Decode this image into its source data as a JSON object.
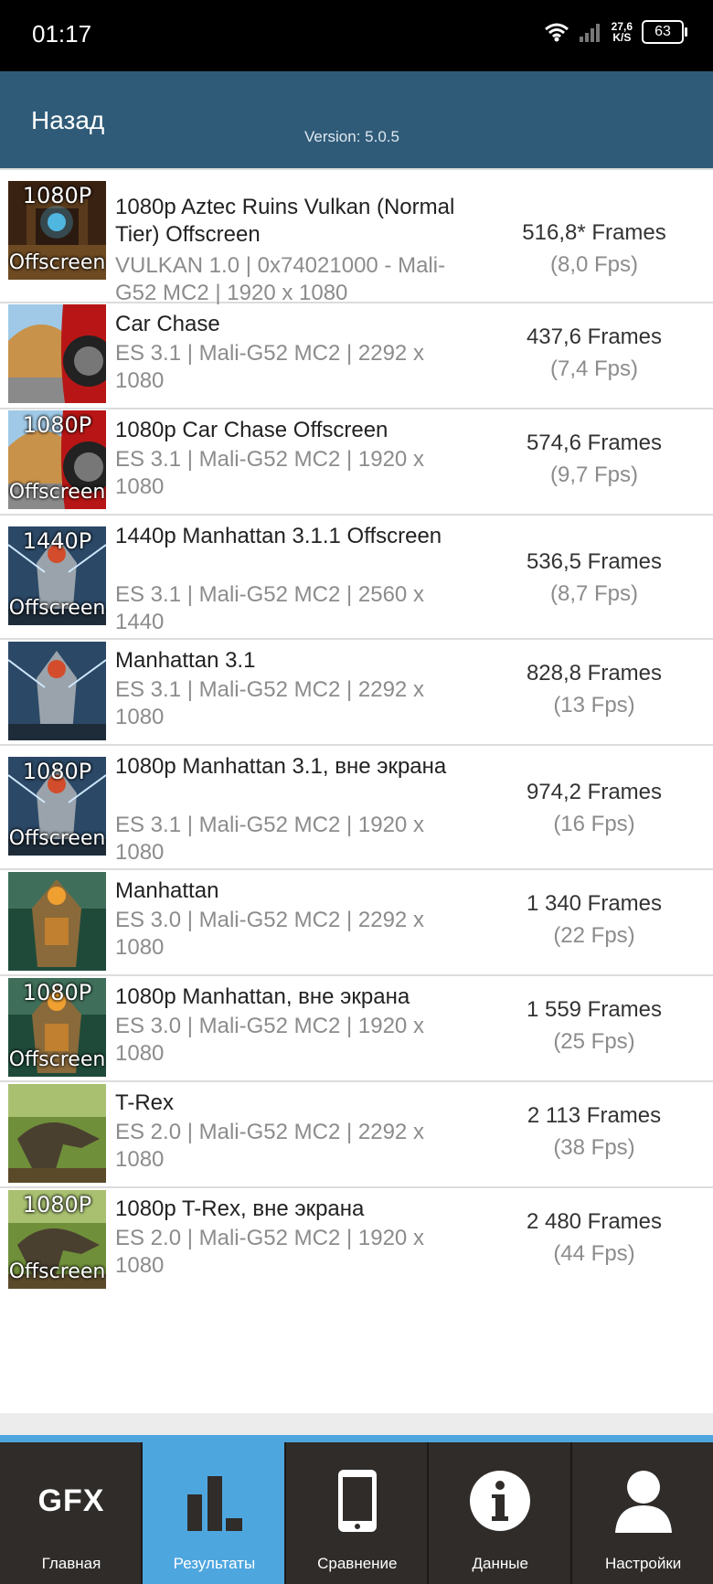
{
  "status": {
    "time": "01:17",
    "speed_top": "27,6",
    "speed_bot": "K/S",
    "battery": "63"
  },
  "header": {
    "back": "Назад",
    "version": "Version: 5.0.5"
  },
  "results": [
    {
      "title": "1080p Aztec Ruins Vulkan (Normal Tier) Offscreen",
      "sub": "VULKAN 1.0 | 0x74021000 - Mali-G52 MC2 | 1920 x 1080",
      "score": "516,8* Frames",
      "fps": "(8,0 Fps)",
      "badge_top": "1080P",
      "badge_bot": "Offscreen"
    },
    {
      "title": "Car Chase",
      "sub": "ES 3.1 | Mali-G52 MC2 | 2292 x 1080",
      "score": "437,6 Frames",
      "fps": "(7,4 Fps)",
      "badge_top": "",
      "badge_bot": ""
    },
    {
      "title": "1080p Car Chase Offscreen",
      "sub": "ES 3.1 | Mali-G52 MC2 | 1920 x 1080",
      "score": "574,6 Frames",
      "fps": "(9,7 Fps)",
      "badge_top": "1080P",
      "badge_bot": "Offscreen"
    },
    {
      "title": "1440p Manhattan 3.1.1 Offscreen",
      "sub": "ES 3.1 | Mali-G52 MC2 | 2560 x 1440",
      "score": "536,5 Frames",
      "fps": "(8,7 Fps)",
      "badge_top": "1440P",
      "badge_bot": "Offscreen"
    },
    {
      "title": "Manhattan 3.1",
      "sub": "ES 3.1 | Mali-G52 MC2 | 2292 x 1080",
      "score": "828,8 Frames",
      "fps": "(13 Fps)",
      "badge_top": "",
      "badge_bot": ""
    },
    {
      "title": "1080p Manhattan 3.1, вне экрана",
      "sub": "ES 3.1 | Mali-G52 MC2 | 1920 x 1080",
      "score": "974,2 Frames",
      "fps": "(16 Fps)",
      "badge_top": "1080P",
      "badge_bot": "Offscreen"
    },
    {
      "title": "Manhattan",
      "sub": "ES 3.0 | Mali-G52 MC2 | 2292 x 1080",
      "score": "1 340 Frames",
      "fps": "(22 Fps)",
      "badge_top": "",
      "badge_bot": ""
    },
    {
      "title": "1080p Manhattan, вне экрана",
      "sub": "ES 3.0 | Mali-G52 MC2 | 1920 x 1080",
      "score": "1 559 Frames",
      "fps": "(25 Fps)",
      "badge_top": "1080P",
      "badge_bot": "Offscreen"
    },
    {
      "title": "T-Rex",
      "sub": "ES 2.0 | Mali-G52 MC2 | 2292 x 1080",
      "score": "2 113 Frames",
      "fps": "(38 Fps)",
      "badge_top": "",
      "badge_bot": ""
    },
    {
      "title": "1080p T-Rex, вне экрана",
      "sub": "ES 2.0 | Mali-G52 MC2 | 1920 x 1080",
      "score": "2 480 Frames",
      "fps": "(44 Fps)",
      "badge_top": "1080P",
      "badge_bot": "Offscreen"
    }
  ],
  "nav": [
    {
      "label": "Главная",
      "icon": "gfx-logo-icon",
      "logo": "GFX"
    },
    {
      "label": "Результаты",
      "icon": "bar-chart-icon"
    },
    {
      "label": "Сравнение",
      "icon": "phone-icon"
    },
    {
      "label": "Данные",
      "icon": "info-icon"
    },
    {
      "label": "Настройки",
      "icon": "user-icon"
    }
  ],
  "colors": {
    "header": "#2f5b78",
    "nav_bg": "#2f2c2a",
    "nav_active": "#4ea6df"
  }
}
